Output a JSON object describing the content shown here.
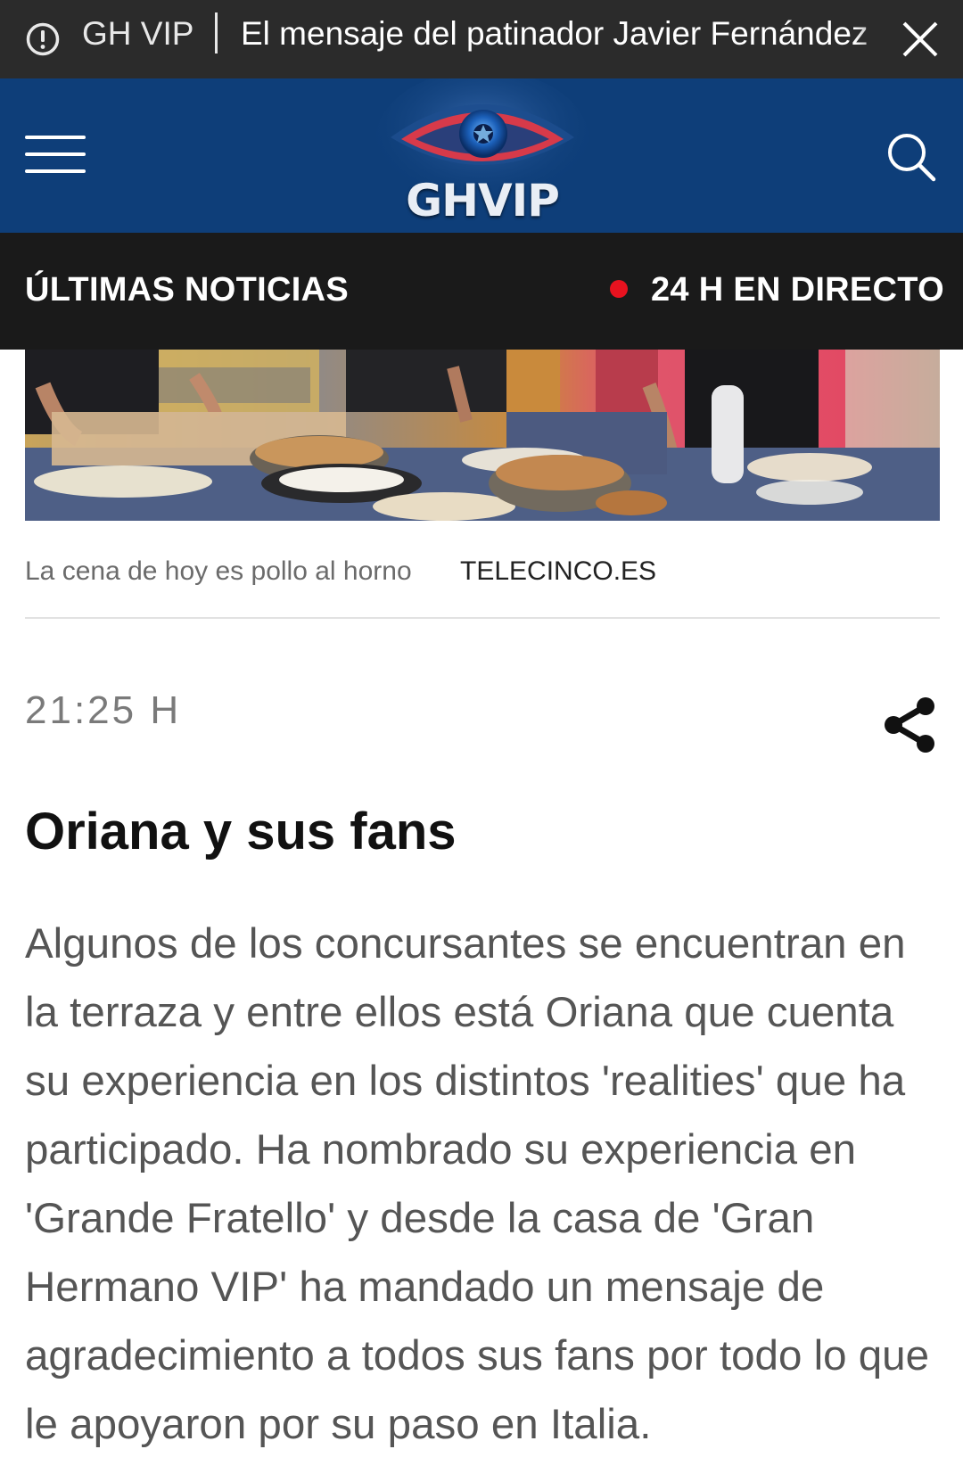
{
  "alert": {
    "source": "GH VIP",
    "headline": "El mensaje del patinador Javier Fernández"
  },
  "header": {
    "logo_text": "GHVIP"
  },
  "nav": {
    "latest_label": "ÚLTIMAS NOTICIAS",
    "live_label": "24 H EN DIRECTO"
  },
  "photo": {
    "caption": "La cena de hoy es pollo al horno",
    "credit": "TELECINCO.ES"
  },
  "entry": {
    "time": "21:25 H",
    "title": "Oriana y sus fans",
    "body": "Algunos de los concursantes se encuentran en la terraza y entre ellos está Oriana que cuenta su experiencia en los distintos 'realities' que ha participado. Ha nombrado su experiencia en 'Grande Fratello' y desde la casa de 'Gran Hermano VIP' ha mandado un mensaje de agradecimiento a todos sus fans por todo lo que le apoyaron por su paso en Italia."
  },
  "colors": {
    "header_bg": "#0e3e79",
    "nav_bg": "#1a1a1a",
    "alert_bg": "#2b2b2b",
    "live_dot": "#e8121f"
  },
  "icons": {
    "alert": "alert-circle-icon",
    "close": "close-icon",
    "menu": "hamburger-menu-icon",
    "search": "search-icon",
    "share": "share-icon"
  }
}
